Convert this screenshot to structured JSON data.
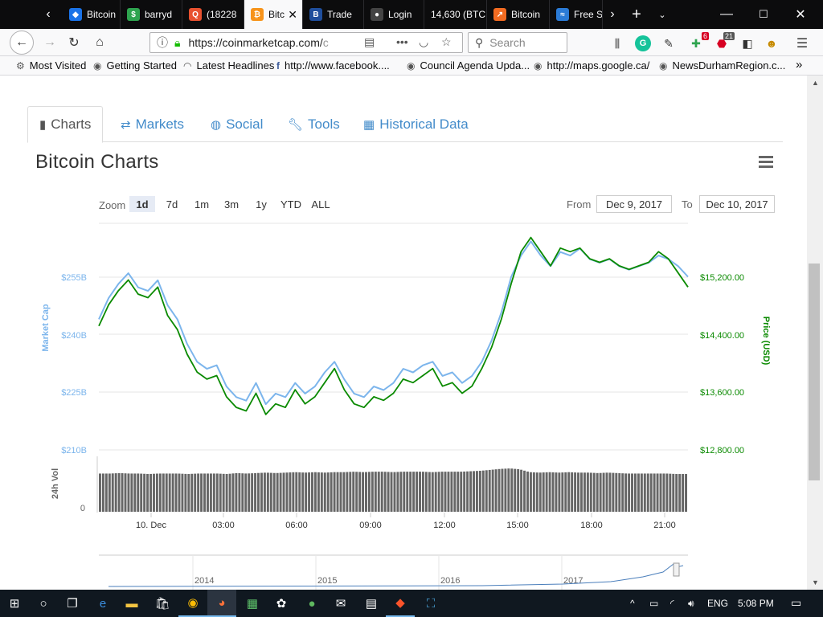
{
  "browser": {
    "tabs": [
      {
        "title": "Bitcoin",
        "color": "#1a73e8",
        "glyph": "◆"
      },
      {
        "title": "barryd",
        "color": "#2ea44f",
        "glyph": "$"
      },
      {
        "title": "(18228",
        "color": "#e8512f",
        "glyph": "Q"
      },
      {
        "title": "Bitc",
        "color": "#f7931a",
        "glyph": "₿"
      },
      {
        "title": "Trade",
        "color": "#1f4e9c",
        "glyph": "B"
      },
      {
        "title": "Login",
        "color": "#444",
        "glyph": "●"
      },
      {
        "title": "14,630 (BTC",
        "color": "#0c0c0d",
        "glyph": ""
      },
      {
        "title": "Bitcoin",
        "color": "#f26b21",
        "glyph": "↗"
      },
      {
        "title": "Free S",
        "color": "#2b7bd6",
        "glyph": "≈"
      }
    ],
    "url": "https://coinmarketcap.com/",
    "url_tail": "c",
    "search_placeholder": "Search",
    "badge_green": "6",
    "badge_red": "21",
    "bookmarks": [
      "Most Visited",
      "Getting Started",
      "Latest Headlines",
      "http://www.facebook....",
      "Council Agenda Upda...",
      "http://maps.google.ca/",
      "NewsDurhamRegion.c..."
    ]
  },
  "page": {
    "tabs": [
      "Charts",
      "Markets",
      "Social",
      "Tools",
      "Historical Data"
    ],
    "title": "Bitcoin Charts",
    "zoom_label": "Zoom",
    "zoom_options": [
      "1d",
      "7d",
      "1m",
      "3m",
      "1y",
      "YTD",
      "ALL"
    ],
    "zoom_selected": "1d",
    "from_label": "From",
    "from_date": "Dec 9, 2017",
    "to_label": "To",
    "to_date": "Dec 10, 2017"
  },
  "chart_data": {
    "type": "line",
    "title": "Bitcoin Charts",
    "x_ticks": [
      "10. Dec",
      "03:00",
      "06:00",
      "09:00",
      "12:00",
      "15:00",
      "18:00",
      "21:00"
    ],
    "left_axis": {
      "label": "Market Cap",
      "ticks": [
        "$255B",
        "$240B",
        "$225B",
        "$210B"
      ],
      "color": "#7cb5ec"
    },
    "right_axis": {
      "label": "Price (USD)",
      "ticks": [
        "$15,200.00",
        "$14,400.00",
        "$13,600.00",
        "$12,800.00"
      ],
      "color": "#0a8a00"
    },
    "volume_axis": {
      "label": "24h Vol",
      "ticks": [
        "0"
      ]
    },
    "navigator_years": [
      "2014",
      "2015",
      "2016",
      "2017"
    ],
    "ylim_price": [
      12800,
      16000
    ],
    "series": [
      {
        "name": "Market Cap",
        "color": "#7cb5ec",
        "values": [
          14600,
          14900,
          15100,
          15250,
          15050,
          15000,
          15150,
          14800,
          14600,
          14250,
          14000,
          13900,
          13950,
          13650,
          13500,
          13450,
          13700,
          13400,
          13550,
          13500,
          13700,
          13550,
          13650,
          13850,
          14000,
          13750,
          13550,
          13500,
          13650,
          13600,
          13700,
          13900,
          13850,
          13950,
          14000,
          13800,
          13850,
          13700,
          13800,
          14000,
          14300,
          14700,
          15200,
          15500,
          15700,
          15500,
          15350,
          15550,
          15500,
          15600,
          15450,
          15400,
          15450,
          15350,
          15300,
          15350,
          15400,
          15500,
          15450,
          15350,
          15200
        ]
      },
      {
        "name": "Price (USD)",
        "color": "#0a8a00",
        "values": [
          14550,
          14850,
          15050,
          15200,
          15000,
          14950,
          15100,
          14700,
          14500,
          14150,
          13900,
          13800,
          13850,
          13550,
          13400,
          13350,
          13600,
          13300,
          13450,
          13400,
          13650,
          13450,
          13550,
          13750,
          13950,
          13650,
          13450,
          13400,
          13550,
          13500,
          13600,
          13800,
          13750,
          13850,
          13950,
          13700,
          13750,
          13600,
          13700,
          13950,
          14250,
          14650,
          15150,
          15600,
          15800,
          15600,
          15400,
          15650,
          15600,
          15650,
          15500,
          15450,
          15500,
          15400,
          15350,
          15400,
          15450,
          15600,
          15500,
          15300,
          15100
        ]
      },
      {
        "name": "24h Vol",
        "color": "#666666",
        "values": [
          0.82,
          0.82,
          0.83,
          0.82,
          0.82,
          0.81,
          0.82,
          0.82,
          0.82,
          0.81,
          0.82,
          0.82,
          0.82,
          0.81,
          0.83,
          0.82,
          0.83,
          0.84,
          0.83,
          0.84,
          0.85,
          0.84,
          0.85,
          0.84,
          0.85,
          0.85,
          0.86,
          0.85,
          0.86,
          0.86,
          0.85,
          0.86,
          0.86,
          0.86,
          0.85,
          0.86,
          0.86,
          0.86,
          0.87,
          0.88,
          0.9,
          0.92,
          0.93,
          0.91,
          0.85,
          0.84,
          0.85,
          0.84,
          0.85,
          0.84,
          0.84,
          0.83,
          0.84,
          0.83,
          0.82,
          0.82,
          0.82,
          0.82,
          0.82,
          0.81,
          0.81
        ]
      }
    ]
  },
  "taskbar": {
    "lang": "ENG",
    "time": "5:08 PM"
  }
}
